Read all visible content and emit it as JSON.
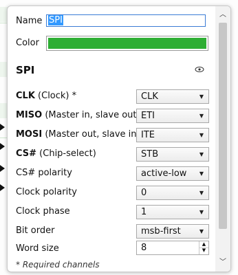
{
  "form": {
    "name_label": "Name",
    "name_value": "SPI",
    "color_label": "Color",
    "color_hex": "#2eae34"
  },
  "section": {
    "title": "SPI"
  },
  "rows": [
    {
      "key": "CLK",
      "desc": " (Clock) *",
      "value": "CLK"
    },
    {
      "key": "MISO",
      "desc": " (Master in, slave out)",
      "value": "ETI"
    },
    {
      "key": "MOSI",
      "desc": " (Master out, slave in)",
      "value": "ITE"
    },
    {
      "key": "CS#",
      "desc": " (Chip-select)",
      "value": "STB"
    },
    {
      "key": "",
      "desc": "CS# polarity",
      "value": "active-low"
    },
    {
      "key": "",
      "desc": "Clock polarity",
      "value": "0"
    },
    {
      "key": "",
      "desc": "Clock phase",
      "value": "1"
    },
    {
      "key": "",
      "desc": "Bit order",
      "value": "msb-first"
    }
  ],
  "word_size": {
    "label": "Word size",
    "value": "8"
  },
  "footnote": "* Required channels",
  "icons": {
    "visibility": "eye-icon",
    "dropdown": "chevron-down-icon",
    "scroll_up": "chevron-up-icon",
    "scroll_down": "chevron-down-icon"
  }
}
